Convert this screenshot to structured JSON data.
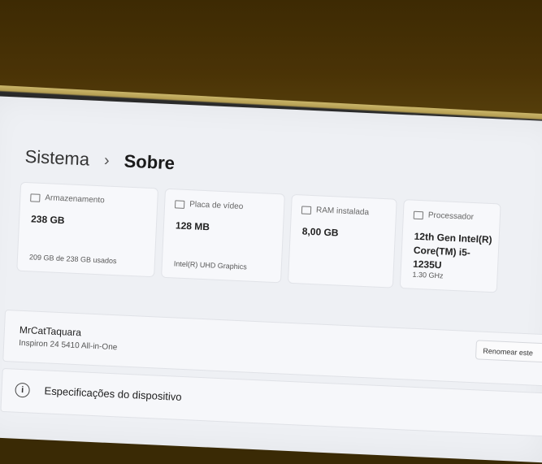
{
  "breadcrumb": {
    "parent": "Sistema",
    "separator": "›",
    "current": "Sobre"
  },
  "cards": [
    {
      "label": "Armazenamento",
      "value": "238 GB",
      "detail": "209 GB de 238 GB usados",
      "icon": "storage-icon"
    },
    {
      "label": "Placa de vídeo",
      "value": "128 MB",
      "detail": "Intel(R) UHD Graphics",
      "icon": "display-adapter-icon"
    },
    {
      "label": "RAM instalada",
      "value": "8,00 GB",
      "detail": "",
      "icon": "ram-icon"
    },
    {
      "label": "Processador",
      "value": "12th Gen Intel(R) Core(TM) i5-1235U",
      "detail": "1.30 GHz",
      "icon": "processor-icon"
    }
  ],
  "device": {
    "name": "MrCatTaquara",
    "model": "Inspiron 24 5410 All-in-One",
    "rename_label": "Renomear este"
  },
  "specs": {
    "label": "Especificações do dispositivo",
    "icon": "info-icon"
  }
}
